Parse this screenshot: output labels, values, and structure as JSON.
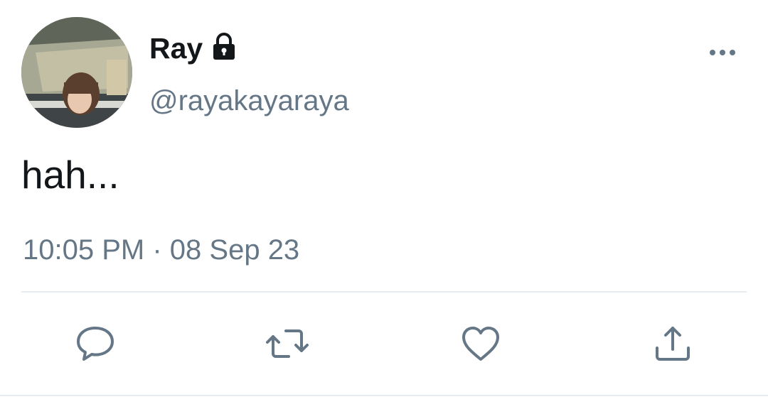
{
  "tweet": {
    "author": {
      "display_name": "Ray",
      "handle": "@rayakayaraya",
      "protected_icon": "lock-icon",
      "avatar": "avatar-image"
    },
    "text": "hah...",
    "time": "10:05 PM",
    "separator": "·",
    "date": "08 Sep 23"
  },
  "actions": [
    {
      "name": "reply",
      "icon": "reply-icon"
    },
    {
      "name": "retweet",
      "icon": "retweet-icon"
    },
    {
      "name": "like",
      "icon": "heart-icon"
    },
    {
      "name": "share",
      "icon": "share-icon"
    }
  ],
  "menu": {
    "icon": "more-icon"
  },
  "colors": {
    "text_primary": "#14171a",
    "text_secondary": "#657786",
    "divider": "#e6ecf0",
    "background": "#ffffff"
  }
}
